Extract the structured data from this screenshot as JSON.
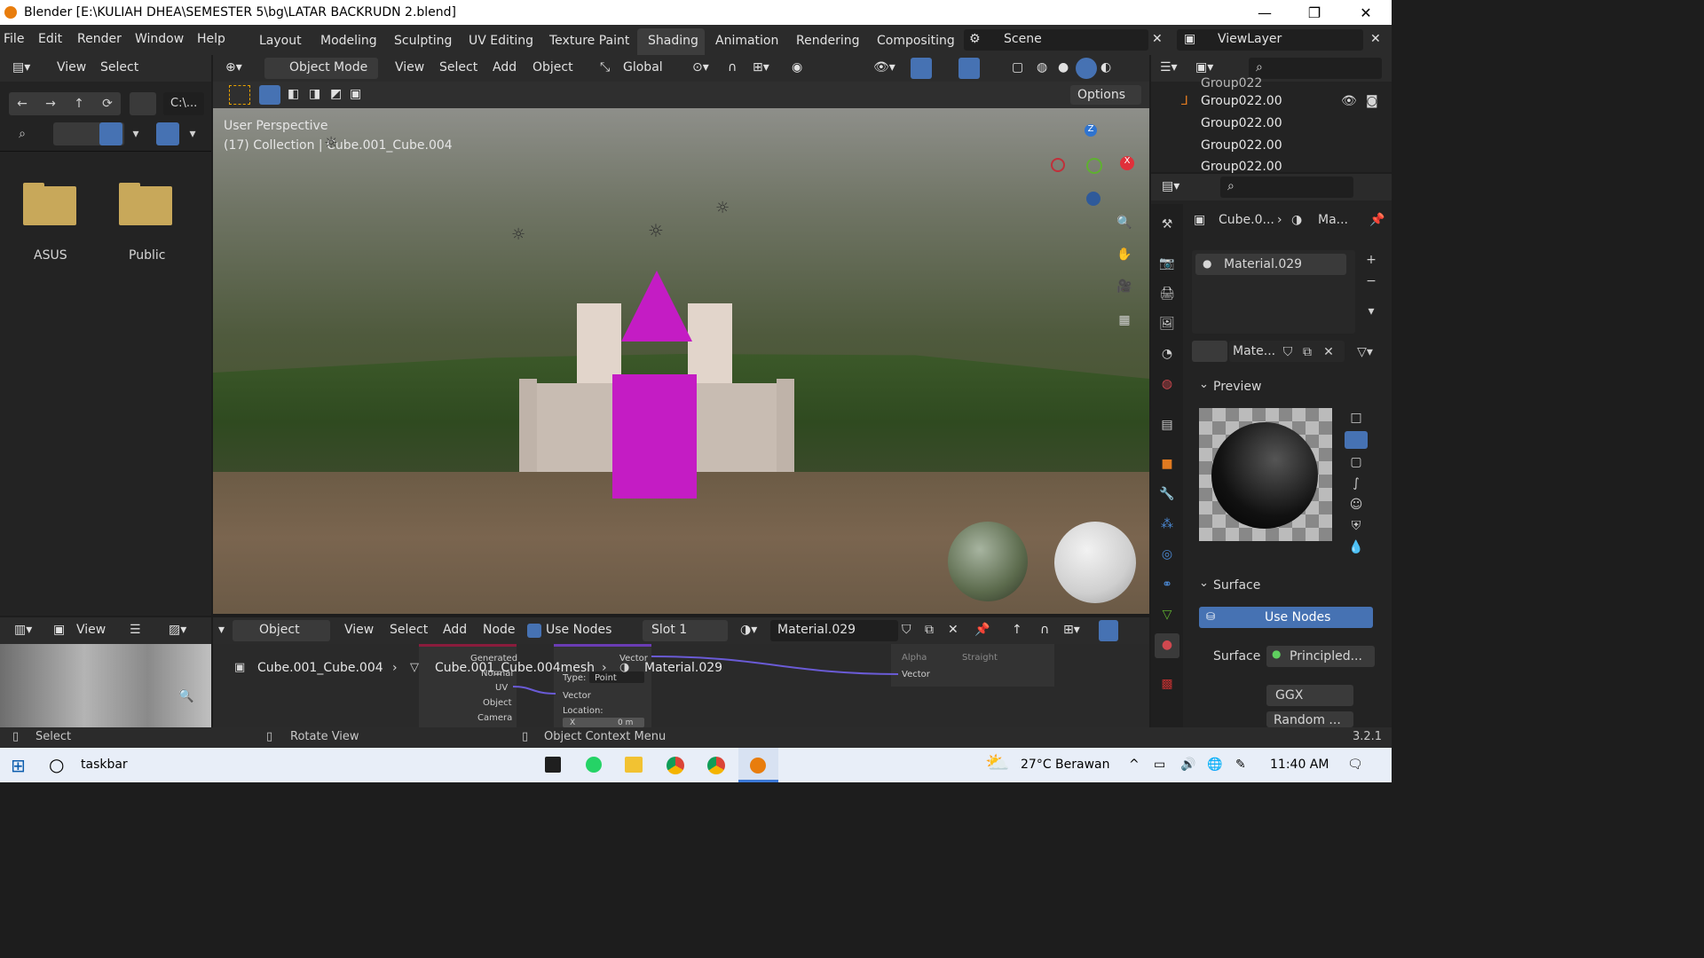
{
  "window": {
    "title": "Blender [E:\\KULIAH DHEA\\SEMESTER 5\\bg\\LATAR BACKRUDN 2.blend]",
    "minimize": "—",
    "maximize": "❐",
    "close": "✕"
  },
  "menu": {
    "file": "File",
    "edit": "Edit",
    "render": "Render",
    "window": "Window",
    "help": "Help"
  },
  "workspaces": [
    "Layout",
    "Modeling",
    "Sculpting",
    "UV Editing",
    "Texture Paint",
    "Shading",
    "Animation",
    "Rendering",
    "Compositing"
  ],
  "scene": {
    "label": "Scene",
    "viewlayer": "ViewLayer"
  },
  "filebrowser": {
    "view": "View",
    "select": "Select",
    "path": "C:\\...",
    "items": [
      {
        "name": "ASUS"
      },
      {
        "name": "Public"
      }
    ]
  },
  "viewport": {
    "mode": "Object Mode",
    "view": "View",
    "select": "Select",
    "add": "Add",
    "object": "Object",
    "orientation": "Global",
    "options": "Options",
    "perspective": "User Perspective",
    "collection": "(17) Collection | Cube.001_Cube.004",
    "axis_z": "Z",
    "axis_x": "X"
  },
  "outliner": {
    "items": [
      "Group022",
      "Group022.00",
      "Group022.00",
      "Group022.00",
      "Group022.00"
    ]
  },
  "properties": {
    "breadcrumb_obj": "Cube.0...",
    "breadcrumb_mat": "Ma...",
    "material_slot": "Material.029",
    "material_name": "Mate...",
    "preview": "Preview",
    "surface": "Surface",
    "use_nodes": "Use Nodes",
    "surface_label": "Surface",
    "surface_value": "Principled...",
    "distribution": "GGX",
    "subsurface": "Random ..."
  },
  "nodeeditor": {
    "object": "Object",
    "view": "View",
    "select": "Select",
    "add": "Add",
    "node": "Node",
    "use_nodes": "Use Nodes",
    "slot": "Slot 1",
    "material": "Material.029",
    "breadcrumb_obj": "Cube.001_Cube.004",
    "breadcrumb_mesh": "Cube.001_Cube.004mesh",
    "breadcrumb_mat": "Material.029",
    "node_outputs": [
      "Generated",
      "Normal",
      "UV",
      "Object",
      "Camera"
    ],
    "mapping": {
      "vector": "Vector",
      "type_label": "Type:",
      "type_value": "Point",
      "location": "Location:",
      "x": "X",
      "x_val": "0 m"
    },
    "right_node": {
      "alpha": "Alpha",
      "straight": "Straight",
      "vector": "Vector"
    }
  },
  "imageeditor": {
    "view": "View"
  },
  "statusbar": {
    "select": "Select",
    "rotate": "Rotate View",
    "context": "Object Context Menu",
    "version": "3.2.1"
  },
  "taskbar": {
    "search": "taskbar",
    "weather": "27°C Berawan",
    "time": "11:40 AM"
  },
  "colors": {
    "accent": "#4672b3",
    "magenta": "#c41cc4",
    "orange": "#e87d0d"
  }
}
